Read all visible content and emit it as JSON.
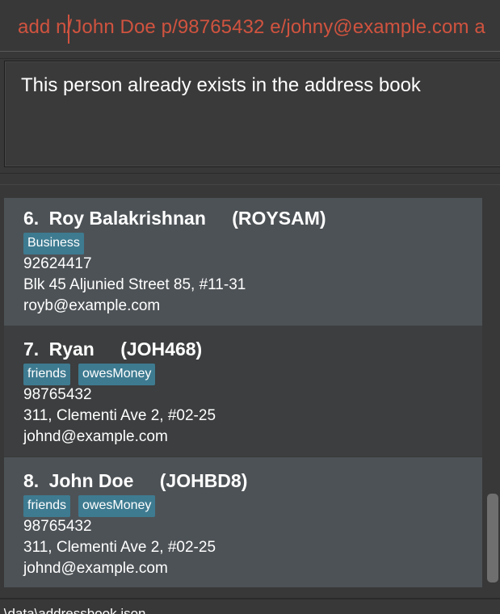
{
  "command": {
    "text": "add n/John Doe p/98765432 e/johny@example.com a"
  },
  "result": {
    "message": "This person already exists in the address book"
  },
  "persons": [
    {
      "index": "6.",
      "name": "Roy Balakrishnan",
      "code": "(ROYSAM)",
      "tags": [
        "Business"
      ],
      "phone": "92624417",
      "address": "Blk 45 Aljunied Street 85, #11-31",
      "email": "royb@example.com"
    },
    {
      "index": "7.",
      "name": "Ryan",
      "code": "(JOH468)",
      "tags": [
        "friends",
        "owesMoney"
      ],
      "phone": "98765432",
      "address": "311, Clementi Ave 2, #02-25",
      "email": "johnd@example.com"
    },
    {
      "index": "8.",
      "name": "John Doe",
      "code": "(JOHBD8)",
      "tags": [
        "friends",
        "owesMoney"
      ],
      "phone": "98765432",
      "address": "311, Clementi Ave 2, #02-25",
      "email": "johnd@example.com"
    }
  ],
  "status": {
    "text": ".\\data\\addressbook.json"
  },
  "colors": {
    "background": "#383838",
    "command_text": "#d0533f",
    "card_odd": "#4d5256",
    "card_even": "#3c3e3f",
    "tag": "#3e7b91"
  }
}
